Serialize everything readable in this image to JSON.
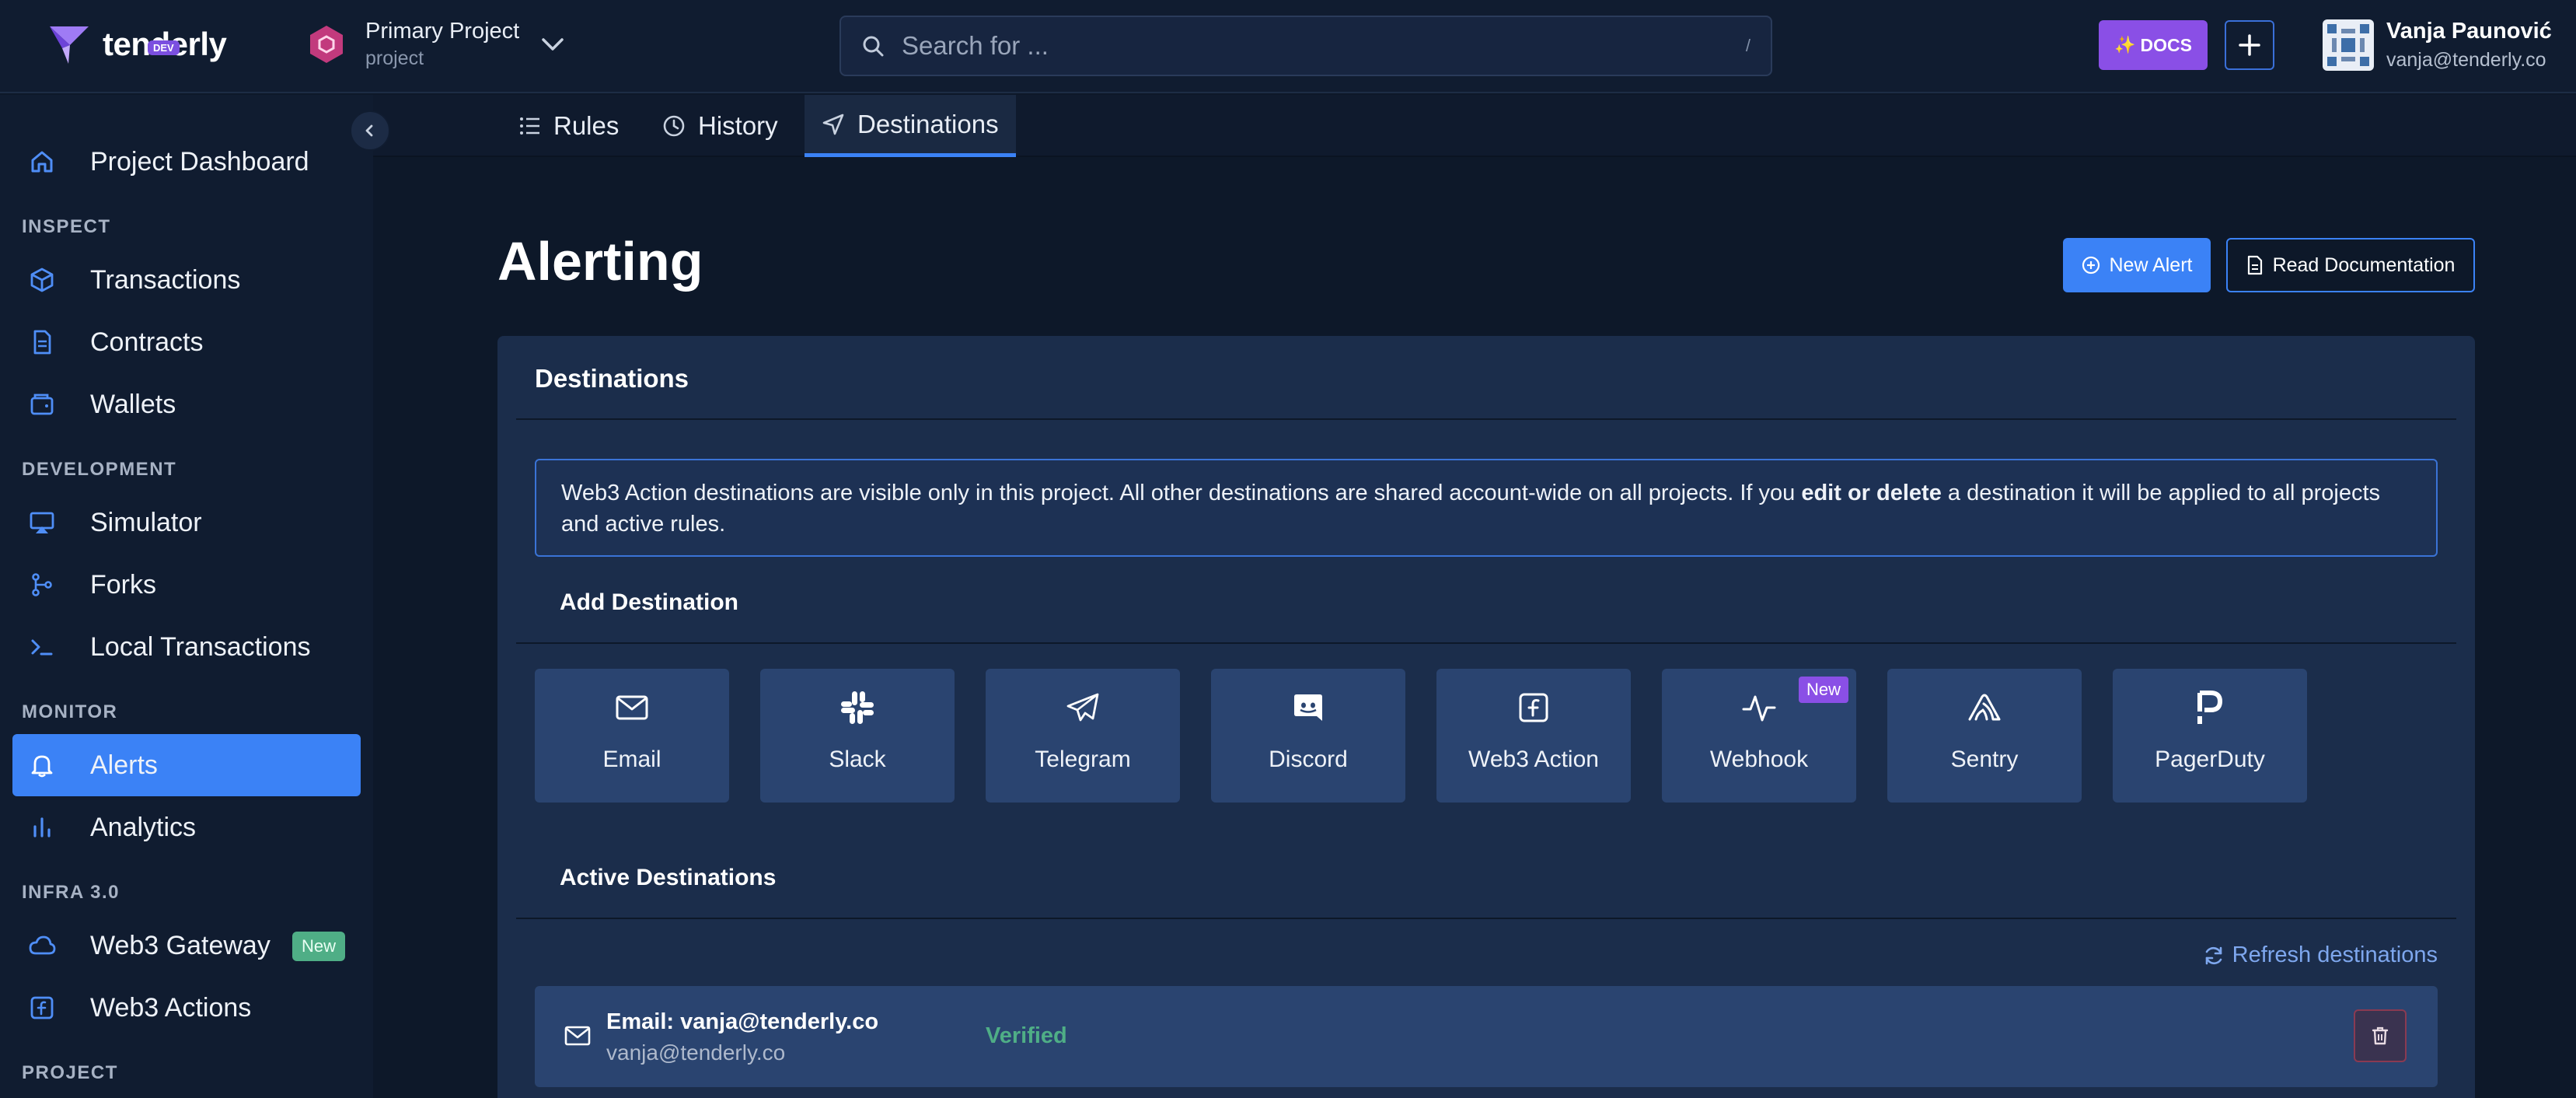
{
  "brand": {
    "name": "tenderly",
    "badge": "DEV"
  },
  "project": {
    "name": "Primary Project",
    "type": "project"
  },
  "search": {
    "placeholder": "Search for ...",
    "shortcut": "/"
  },
  "header": {
    "docs_label": "DOCS"
  },
  "user": {
    "name": "Vanja Paunović",
    "email": "vanja@tenderly.co"
  },
  "sidebar": {
    "top_item": "Project Dashboard",
    "sections": {
      "inspect": "INSPECT",
      "development": "DEVELOPMENT",
      "monitor": "MONITOR",
      "infra": "INFRA 3.0",
      "project": "PROJECT"
    },
    "items": {
      "transactions": "Transactions",
      "contracts": "Contracts",
      "wallets": "Wallets",
      "simulator": "Simulator",
      "forks": "Forks",
      "local_transactions": "Local Transactions",
      "alerts": "Alerts",
      "analytics": "Analytics",
      "web3_gateway": "Web3 Gateway",
      "web3_actions": "Web3 Actions"
    },
    "new_badge": "New"
  },
  "tabs": {
    "rules": "Rules",
    "history": "History",
    "destinations": "Destinations"
  },
  "page": {
    "title": "Alerting",
    "new_alert": "New Alert",
    "read_docs": "Read Documentation"
  },
  "panel": {
    "title": "Destinations",
    "info_pre": "Web3 Action destinations are visible only in this project. All other destinations are shared account-wide on all projects. If you ",
    "info_bold": "edit or delete",
    "info_post": " a destination it will be applied to all projects and active rules.",
    "add_title": "Add Destination",
    "destinations": {
      "email": "Email",
      "slack": "Slack",
      "telegram": "Telegram",
      "discord": "Discord",
      "web3_action": "Web3 Action",
      "webhook": "Webhook",
      "sentry": "Sentry",
      "pagerduty": "PagerDuty"
    },
    "webhook_badge": "New",
    "active_title": "Active Destinations",
    "refresh": "Refresh destinations",
    "active": [
      {
        "title": "Email: vanja@tenderly.co",
        "subtitle": "vanja@tenderly.co",
        "status": "Verified"
      }
    ]
  },
  "colors": {
    "accent": "#3b82f6",
    "purple": "#8a4fe6",
    "verified": "#4fae86",
    "background": "#0d1829"
  }
}
